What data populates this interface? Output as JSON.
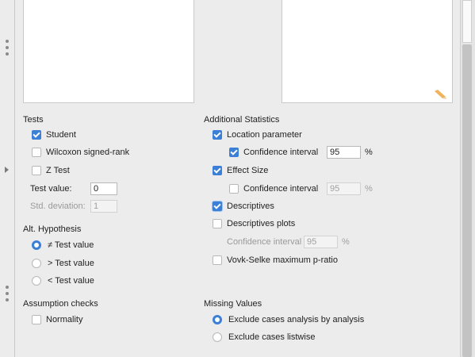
{
  "tests": {
    "title": "Tests",
    "student": "Student",
    "wilcoxon": "Wilcoxon signed-rank",
    "z_test": "Z Test",
    "test_value_label": "Test value:",
    "test_value": "0",
    "std_dev_label": "Std. deviation:",
    "std_dev_value": "1"
  },
  "alt_hypothesis": {
    "title": "Alt. Hypothesis",
    "options": [
      "≠ Test value",
      "> Test value",
      "< Test value"
    ]
  },
  "assumption_checks": {
    "title": "Assumption checks",
    "normality": "Normality"
  },
  "additional_statistics": {
    "title": "Additional Statistics",
    "location_parameter": "Location parameter",
    "ci_label": "Confidence interval",
    "ci_value": "95",
    "percent": "%",
    "effect_size": "Effect Size",
    "effect_ci_label": "Confidence interval",
    "effect_ci_value": "95",
    "descriptives": "Descriptives",
    "descriptives_plots": "Descriptives plots",
    "plots_ci_label": "Confidence interval",
    "plots_ci_value": "95",
    "vovk_sellke": "Vovk-Selke maximum p-ratio"
  },
  "missing_values": {
    "title": "Missing Values",
    "options": [
      "Exclude cases analysis by analysis",
      "Exclude cases listwise"
    ]
  },
  "colors": {
    "accent": "#3b7fd6",
    "background": "#ececec"
  },
  "icons": {
    "pencil": "pencil-icon",
    "drag_handle": "drag-handle-icon",
    "expand": "expand-arrow-icon"
  }
}
